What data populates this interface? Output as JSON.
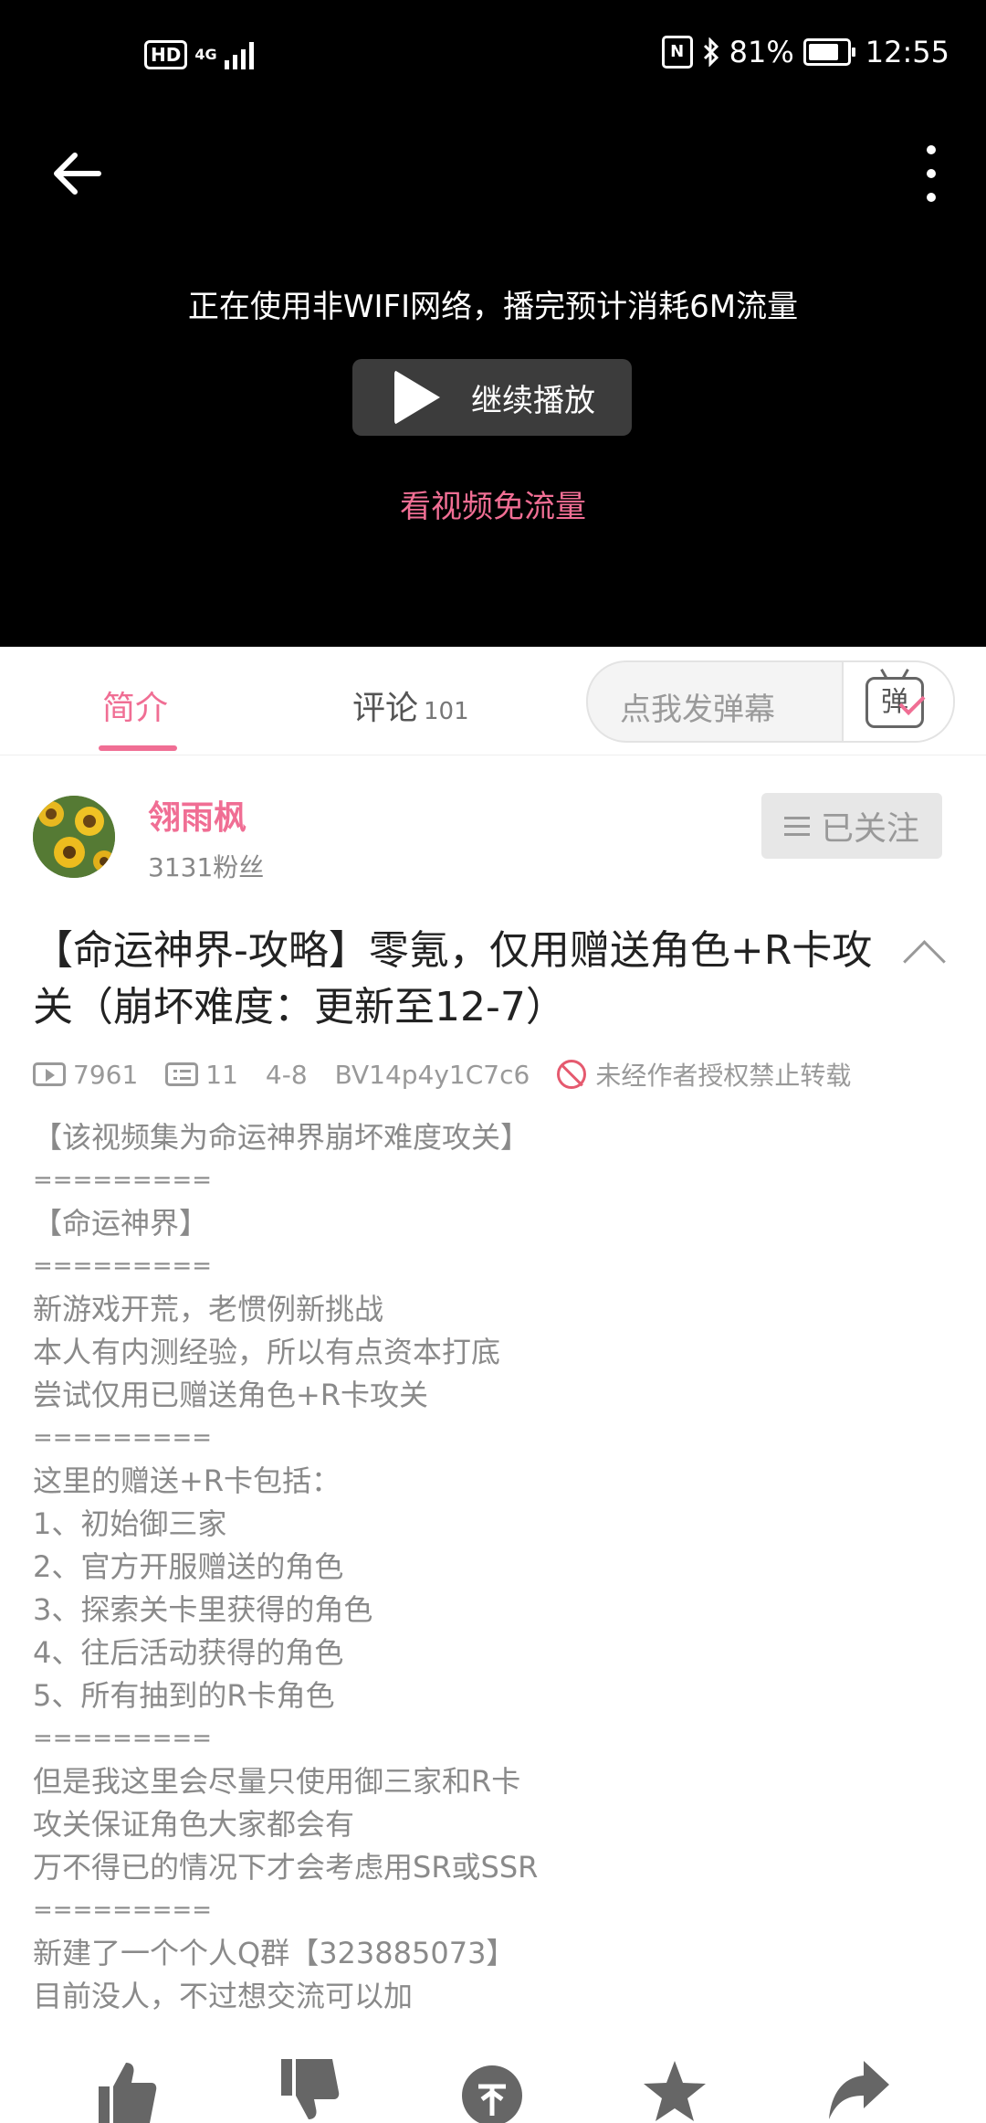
{
  "status_bar": {
    "hd": "HD",
    "network": "4G",
    "battery": "81%",
    "time": "12:55"
  },
  "player": {
    "notice": "正在使用非WIFI网络，播完预计消耗6M流量",
    "continue_label": "继续播放",
    "free_flow_label": "看视频免流量"
  },
  "tabs": {
    "intro": "简介",
    "comments": "评论",
    "comments_count": "101",
    "danmaku_placeholder": "点我发弹幕",
    "danmaku_icon_glyph": "弹"
  },
  "uploader": {
    "name": "翎雨枫",
    "fans": "3131粉丝",
    "follow_label": "已关注"
  },
  "video": {
    "title": "【命运神界-攻略】零氪，仅用赠送角色+R卡攻关（崩坏难度：更新至12-7）",
    "views": "7961",
    "danmaku_count": "11",
    "date": "4-8",
    "bvid": "BV14p4y1C7c6",
    "copyright": "未经作者授权禁止转载"
  },
  "description": [
    "【该视频集为命运神界崩坏难度攻关】",
    "=========",
    "【命运神界】",
    "=========",
    "新游戏开荒，老惯例新挑战",
    "本人有内测经验，所以有点资本打底",
    "尝试仅用已赠送角色+R卡攻关",
    "=========",
    "这里的赠送+R卡包括：",
    "1、初始御三家",
    "2、官方开服赠送的角色",
    "3、探索关卡里获得的角色",
    "4、往后活动获得的角色",
    "5、所有抽到的R卡角色",
    "=========",
    "但是我这里会尽量只使用御三家和R卡",
    "攻关保证角色大家都会有",
    "万不得已的情况下才会考虑用SR或SSR",
    "=========",
    "新建了一个个人Q群【323885073】",
    "目前没人，不过想交流可以加"
  ],
  "colors": {
    "accent": "#f06e94",
    "video_bg": "#000000"
  }
}
